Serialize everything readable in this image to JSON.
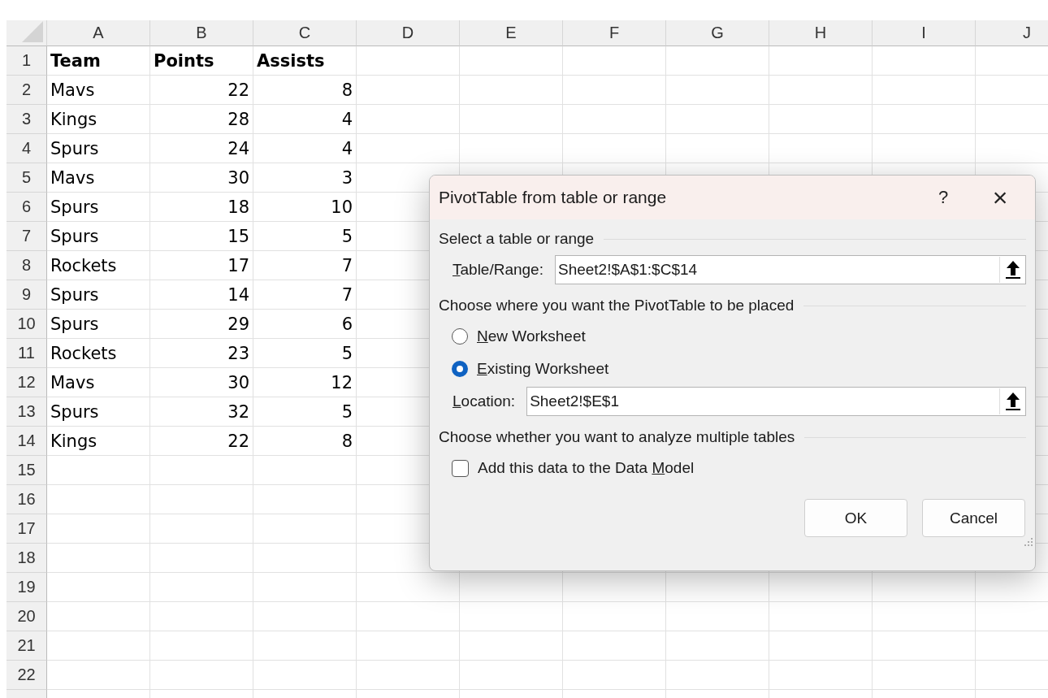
{
  "sheet": {
    "columns": [
      "A",
      "B",
      "C",
      "D",
      "E",
      "F",
      "G",
      "H",
      "I",
      "J"
    ],
    "rows": [
      {
        "number": "1",
        "kind": "header",
        "cells": [
          {
            "text": "Team",
            "kind": "text"
          },
          {
            "text": "Points",
            "kind": "text"
          },
          {
            "text": "Assists",
            "kind": "text"
          }
        ]
      },
      {
        "number": "2",
        "kind": "data",
        "cells": [
          {
            "text": "Mavs",
            "kind": "text"
          },
          {
            "text": "22",
            "kind": "number"
          },
          {
            "text": "8",
            "kind": "number"
          }
        ]
      },
      {
        "number": "3",
        "kind": "data",
        "cells": [
          {
            "text": "Kings",
            "kind": "text"
          },
          {
            "text": "28",
            "kind": "number"
          },
          {
            "text": "4",
            "kind": "number"
          }
        ]
      },
      {
        "number": "4",
        "kind": "data",
        "cells": [
          {
            "text": "Spurs",
            "kind": "text"
          },
          {
            "text": "24",
            "kind": "number"
          },
          {
            "text": "4",
            "kind": "number"
          }
        ]
      },
      {
        "number": "5",
        "kind": "data",
        "cells": [
          {
            "text": "Mavs",
            "kind": "text"
          },
          {
            "text": "30",
            "kind": "number"
          },
          {
            "text": "3",
            "kind": "number"
          }
        ]
      },
      {
        "number": "6",
        "kind": "data",
        "cells": [
          {
            "text": "Spurs",
            "kind": "text"
          },
          {
            "text": "18",
            "kind": "number"
          },
          {
            "text": "10",
            "kind": "number"
          }
        ]
      },
      {
        "number": "7",
        "kind": "data",
        "cells": [
          {
            "text": "Spurs",
            "kind": "text"
          },
          {
            "text": "15",
            "kind": "number"
          },
          {
            "text": "5",
            "kind": "number"
          }
        ]
      },
      {
        "number": "8",
        "kind": "data",
        "cells": [
          {
            "text": "Rockets",
            "kind": "text"
          },
          {
            "text": "17",
            "kind": "number"
          },
          {
            "text": "7",
            "kind": "number"
          }
        ]
      },
      {
        "number": "9",
        "kind": "data",
        "cells": [
          {
            "text": "Spurs",
            "kind": "text"
          },
          {
            "text": "14",
            "kind": "number"
          },
          {
            "text": "7",
            "kind": "number"
          }
        ]
      },
      {
        "number": "10",
        "kind": "data",
        "cells": [
          {
            "text": "Spurs",
            "kind": "text"
          },
          {
            "text": "29",
            "kind": "number"
          },
          {
            "text": "6",
            "kind": "number"
          }
        ]
      },
      {
        "number": "11",
        "kind": "data",
        "cells": [
          {
            "text": "Rockets",
            "kind": "text"
          },
          {
            "text": "23",
            "kind": "number"
          },
          {
            "text": "5",
            "kind": "number"
          }
        ]
      },
      {
        "number": "12",
        "kind": "data",
        "cells": [
          {
            "text": "Mavs",
            "kind": "text"
          },
          {
            "text": "30",
            "kind": "number"
          },
          {
            "text": "12",
            "kind": "number"
          }
        ]
      },
      {
        "number": "13",
        "kind": "data",
        "cells": [
          {
            "text": "Spurs",
            "kind": "text"
          },
          {
            "text": "32",
            "kind": "number"
          },
          {
            "text": "5",
            "kind": "number"
          }
        ]
      },
      {
        "number": "14",
        "kind": "data",
        "cells": [
          {
            "text": "Kings",
            "kind": "text"
          },
          {
            "text": "22",
            "kind": "number"
          },
          {
            "text": "8",
            "kind": "number"
          }
        ]
      },
      {
        "number": "15",
        "kind": "data",
        "cells": []
      },
      {
        "number": "16",
        "kind": "data",
        "cells": []
      },
      {
        "number": "17",
        "kind": "data",
        "cells": []
      },
      {
        "number": "18",
        "kind": "data",
        "cells": []
      },
      {
        "number": "19",
        "kind": "data",
        "cells": []
      },
      {
        "number": "20",
        "kind": "data",
        "cells": []
      },
      {
        "number": "21",
        "kind": "data",
        "cells": []
      },
      {
        "number": "22",
        "kind": "data",
        "cells": []
      }
    ]
  },
  "dialog": {
    "title": "PivotTable from table or range",
    "help": "?",
    "close": "×",
    "sections": [
      {
        "heading": "Select a table or range",
        "items": [
          {
            "kind": "field",
            "label_parts": [
              {
                "text": "T",
                "underline": true
              },
              {
                "text": "able/Range:",
                "underline": false
              }
            ],
            "value": "Sheet2!$A$1:$C$14"
          }
        ]
      },
      {
        "heading": "Choose where you want the PivotTable to be placed",
        "items": [
          {
            "kind": "radio",
            "selected": false,
            "label_parts": [
              {
                "text": "N",
                "underline": true
              },
              {
                "text": "ew Worksheet",
                "underline": false
              }
            ]
          },
          {
            "kind": "radio",
            "selected": true,
            "label_parts": [
              {
                "text": "E",
                "underline": true
              },
              {
                "text": "xisting Worksheet",
                "underline": false
              }
            ]
          },
          {
            "kind": "field",
            "label_parts": [
              {
                "text": "L",
                "underline": true
              },
              {
                "text": "ocation:",
                "underline": false
              }
            ],
            "value": "Sheet2!$E$1"
          }
        ]
      },
      {
        "heading": "Choose whether you want to analyze multiple tables",
        "items": [
          {
            "kind": "checkbox",
            "checked": false,
            "label_parts": [
              {
                "text": "Add this data to the Data ",
                "underline": false
              },
              {
                "text": "M",
                "underline": true
              },
              {
                "text": "odel",
                "underline": false
              }
            ]
          }
        ]
      }
    ],
    "buttons": [
      "OK",
      "Cancel"
    ]
  }
}
